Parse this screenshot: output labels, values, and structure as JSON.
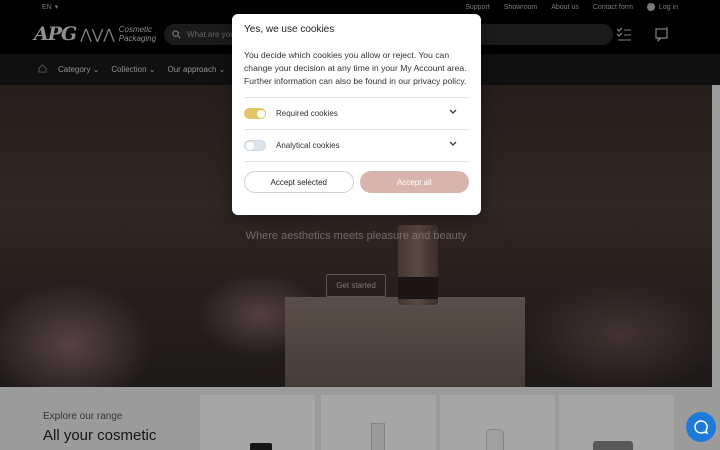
{
  "topbar": {
    "language": "EN",
    "links": [
      "Support",
      "Showroom",
      "About us",
      "Contact form"
    ],
    "login": "Log in"
  },
  "header": {
    "logo_text": "APG",
    "logo_tagline_1": "Cosmetic",
    "logo_tagline_2": "Packaging",
    "search_placeholder": "What are you looking for?"
  },
  "nav": {
    "items": [
      "Category",
      "Collection",
      "Our approach"
    ]
  },
  "hero": {
    "subtitle": "Where aesthetics meets pleasure and beauty",
    "cta": "Get started"
  },
  "range": {
    "kicker": "Explore our range",
    "title": "All your cosmetic"
  },
  "cookie": {
    "title": "Yes, we use cookies",
    "body": "You decide which cookies you allow or reject. You can change your decision at any time in your My Account area. Further information can also be found in our privacy policy.",
    "options": [
      {
        "label": "Required cookies",
        "enabled": true
      },
      {
        "label": "Analytical cookies",
        "enabled": false
      }
    ],
    "accept_selected": "Accept selected",
    "accept_all": "Accept all"
  },
  "colors": {
    "toggle_on": "#e3c466",
    "accept_all_bg": "#d9b3ad",
    "chat_bubble": "#1d7ad9"
  }
}
